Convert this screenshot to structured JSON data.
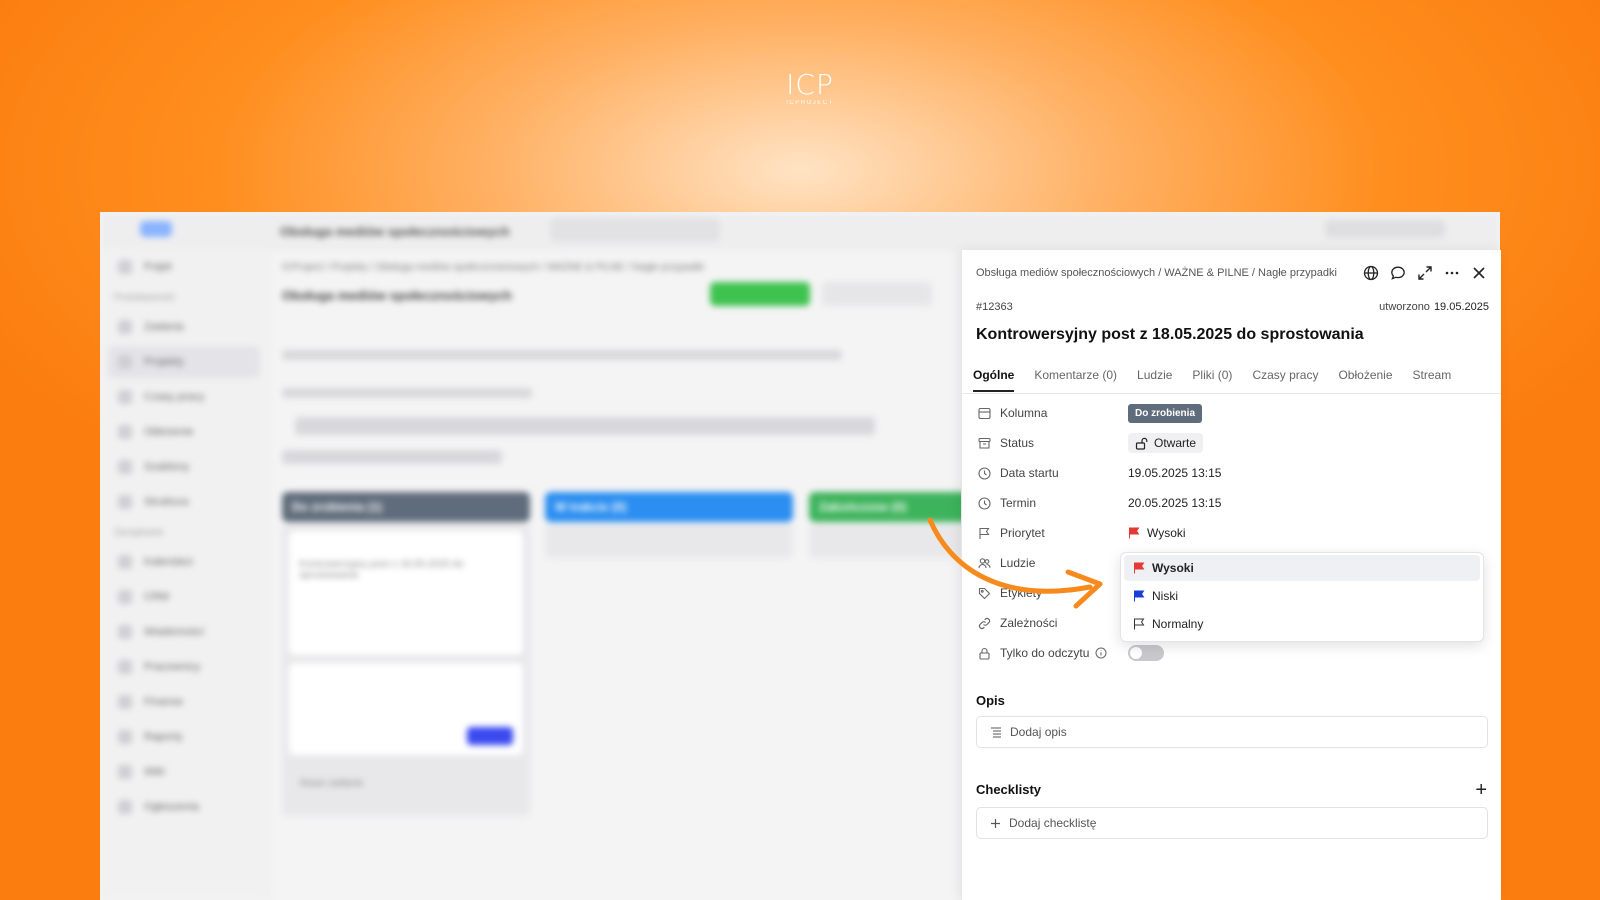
{
  "logo": {
    "mark": "ICP",
    "sub": "ICPROJECT"
  },
  "background_app": {
    "project_title": "Obsługa mediów społecznościowych",
    "breadcrumb": "ICProject / Projekty / Obsługa mediów społecznościowych / WAŻNE & PILNE / Nagłe przypadki",
    "columns": [
      "Do zrobienia (1)",
      "W trakcie (0)",
      "Zakończone (0)"
    ],
    "card_text": "Kontrowersyjny post z 18.05.2025 do sprostowania",
    "new_task": "Nowe zadanie",
    "colors": {
      "todo": "#5f6c7b",
      "inprogress": "#2b8ef0",
      "done": "#3db35b",
      "accent_green": "#3fc34f"
    }
  },
  "panel": {
    "breadcrumb": "Obsługa mediów społecznościowych / WAŻNE & PILNE / Nagłe przypadki",
    "task_id": "#12363",
    "created_label": "utworzono",
    "created_date": "19.05.2025",
    "title": "Kontrowersyjny post z 18.05.2025 do sprostowania",
    "header_icons": [
      "globe-icon",
      "comment-icon",
      "expand-icon",
      "more-icon",
      "close-icon"
    ],
    "tabs": [
      {
        "label": "Ogólne",
        "active": true
      },
      {
        "label": "Komentarze (0)"
      },
      {
        "label": "Ludzie"
      },
      {
        "label": "Pliki (0)"
      },
      {
        "label": "Czasy pracy"
      },
      {
        "label": "Obłożenie"
      },
      {
        "label": "Stream"
      }
    ],
    "fields": {
      "kolumna": {
        "label": "Kolumna",
        "value": "Do zrobienia"
      },
      "status": {
        "label": "Status",
        "value": "Otwarte"
      },
      "data_startu": {
        "label": "Data startu",
        "value": "19.05.2025 13:15"
      },
      "termin": {
        "label": "Termin",
        "value": "20.05.2025 13:15"
      },
      "priorytet": {
        "label": "Priorytet",
        "value": "Wysoki"
      },
      "ludzie": {
        "label": "Ludzie"
      },
      "etykiety": {
        "label": "Etykiety"
      },
      "zaleznosci": {
        "label": "Zależności"
      },
      "tylko_do_odczytu": {
        "label": "Tylko do odczytu",
        "value": false
      }
    },
    "priority_options": [
      {
        "label": "Wysoki",
        "color": "#e53935",
        "selected": true
      },
      {
        "label": "Niski",
        "color": "#1a3fd8"
      },
      {
        "label": "Normalny",
        "color": "outline"
      }
    ],
    "opis": {
      "heading": "Opis",
      "placeholder": "Dodaj opis"
    },
    "checklisty": {
      "heading": "Checklisty",
      "placeholder": "Dodaj checklistę"
    }
  }
}
